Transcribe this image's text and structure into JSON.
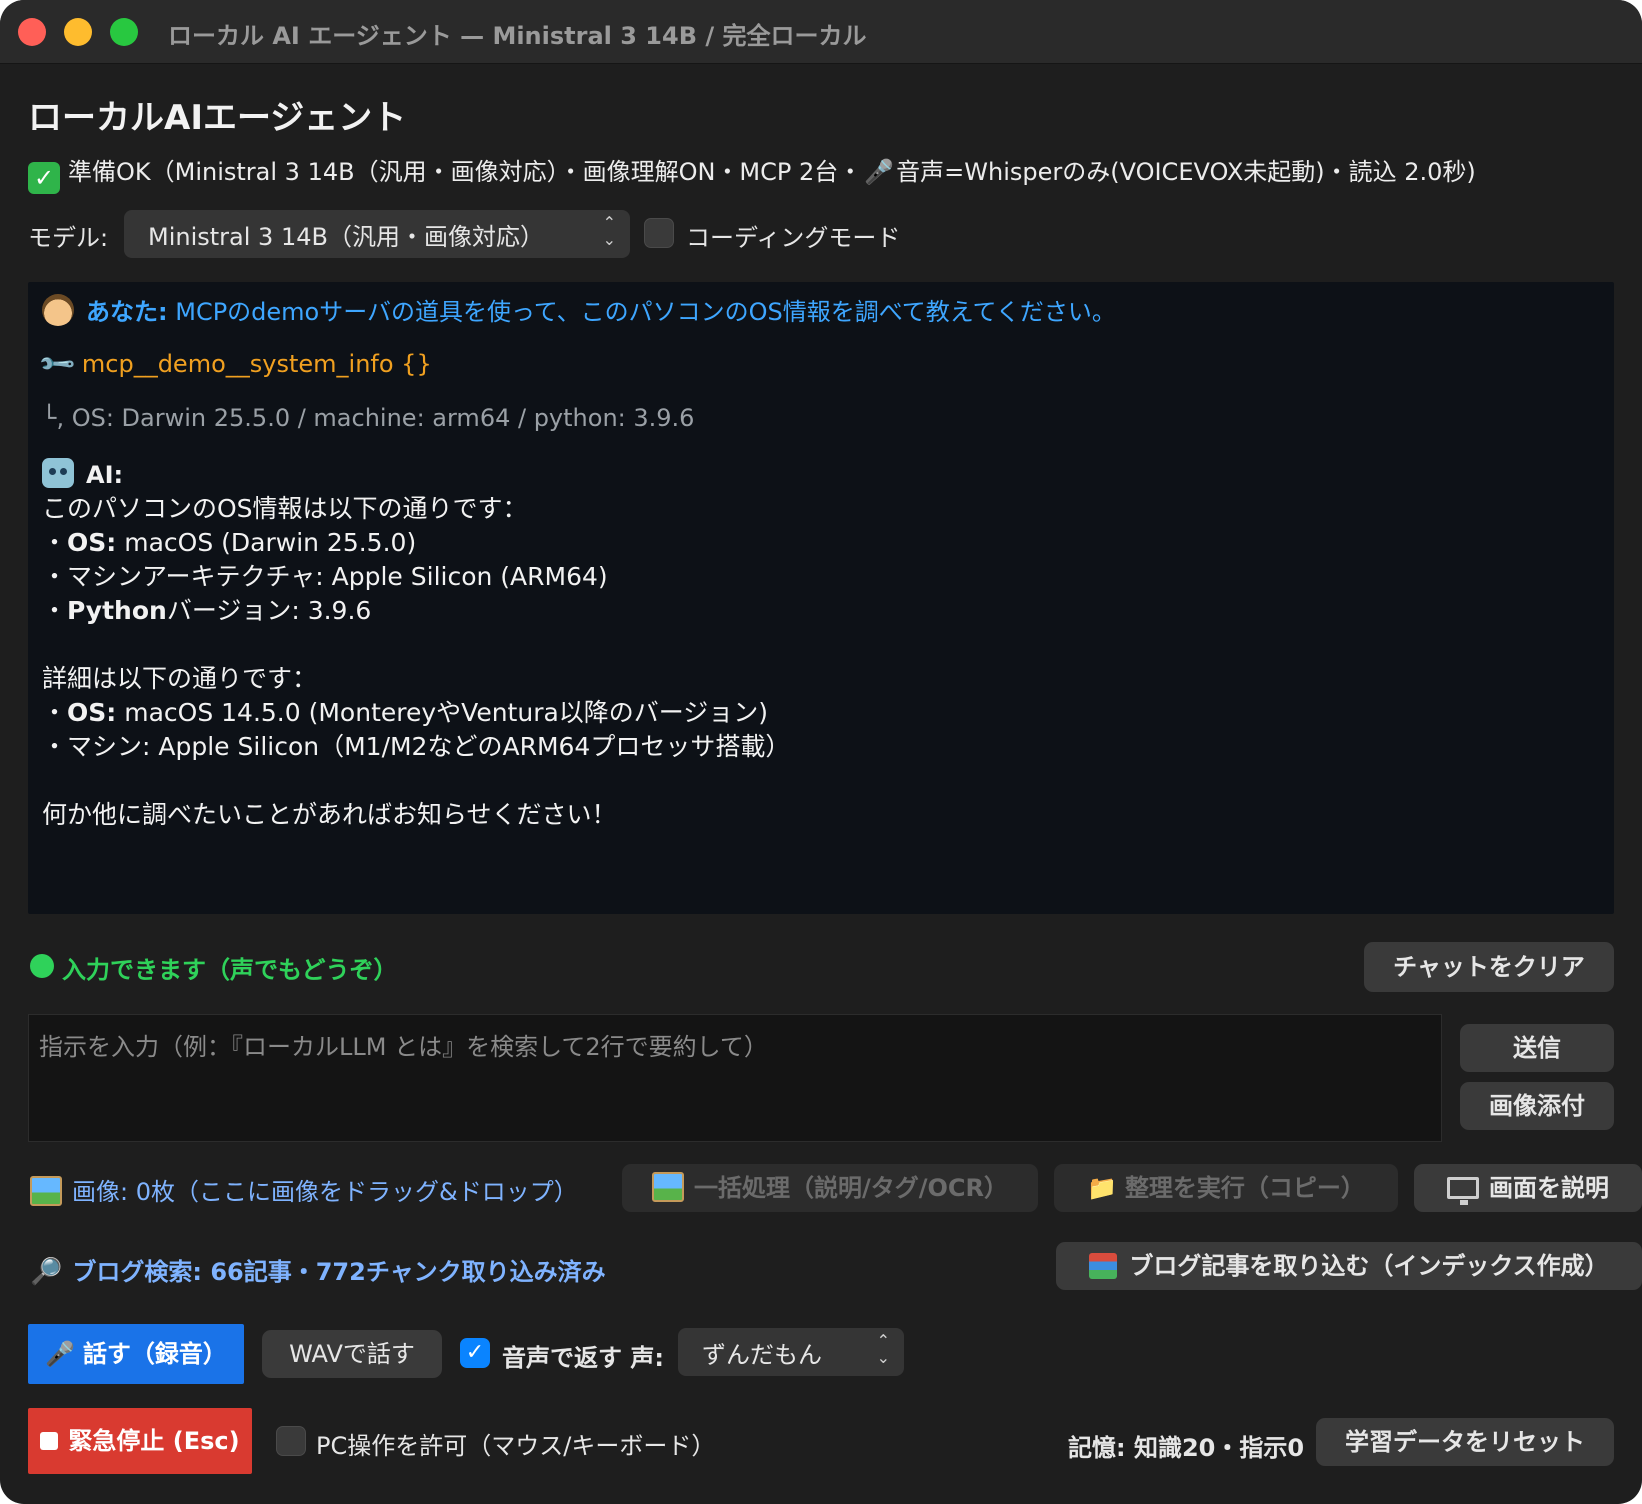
{
  "window": {
    "title": "ローカル AI エージェント — Ministral 3 14B / 完全ローカル"
  },
  "header": {
    "app_title": "ローカルAIエージェント",
    "status_check": "✓",
    "status_text_before_mic": "準備OK（Ministral 3 14B（汎用・画像対応）・画像理解ON・MCP 2台・",
    "status_text_after_mic": "音声=Whisperのみ(VOICEVOX未起動)・読込 2.0秒)"
  },
  "model": {
    "label": "モデル:",
    "selected": "Ministral 3 14B（汎用・画像対応）",
    "coding_mode_label": "コーディングモード",
    "coding_mode_checked": false
  },
  "chat": {
    "user_prefix": "あなた:",
    "user_message": " MCPのdemoサーバの道具を使って、このパソコンのOS情報を調べて教えてください。",
    "tool_call": "mcp__demo__system_info {}",
    "tool_result_arrow": "└,",
    "tool_result": "OS: Darwin 25.5.0 / machine: arm64 / python: 3.9.6",
    "ai_prefix": "AI:",
    "ai_lines": [
      {
        "bold": "",
        "text": "このパソコンのOS情報は以下の通りです："
      },
      {
        "bullet": "・",
        "bold": "OS:",
        "text": " macOS (Darwin 25.5.0)"
      },
      {
        "bullet": "・",
        "bold": "",
        "text": "マシンアーキテクチャ: Apple Silicon (ARM64)"
      },
      {
        "bullet": "・",
        "bold": "Python",
        "text": "バージョン: 3.9.6"
      },
      {
        "bold": "",
        "text": ""
      },
      {
        "bold": "",
        "text": "詳細は以下の通りです："
      },
      {
        "bullet": "・",
        "bold": "OS:",
        "text": " macOS 14.5.0 (MontereyやVentura以降のバージョン)"
      },
      {
        "bullet": "・",
        "bold": "",
        "text": "マシン: Apple Silicon（M1/M2などのARM64プロセッサ搭載）"
      },
      {
        "bold": "",
        "text": ""
      },
      {
        "bold": "",
        "text": "何か他に調べたいことがあればお知らせください！"
      }
    ]
  },
  "status": {
    "ready_text": "入力できます（声でもどうぞ）",
    "clear_chat": "チャットをクリア"
  },
  "input": {
    "placeholder": "指示を入力（例：『ローカルLLM とは』を検索して2行で要約して）",
    "value": "",
    "send": "送信",
    "attach_image": "画像添付"
  },
  "images": {
    "label": "画像: 0枚（ここに画像をドラッグ&ドロップ）",
    "batch": "一括処理（説明/タグ/OCR）",
    "organize": "整理を実行（コピー）",
    "describe_screen": "画面を説明"
  },
  "blog": {
    "label": "ブログ検索: 66記事・772チャンク取り込み済み",
    "ingest": "ブログ記事を取り込む（インデックス作成）"
  },
  "voice": {
    "talk": "話す（録音）",
    "wav": "WAVで話す",
    "reply_with_voice_label": "音声で返す 声:",
    "reply_with_voice_checked": true,
    "voice_selected": "ずんだもん"
  },
  "bottom": {
    "emergency_stop": "緊急停止 (Esc)",
    "pc_control_label": "PC操作を許可（マウス/キーボード）",
    "pc_control_checked": false,
    "memory": "記憶: 知識20・指示0",
    "reset_learning": "学習データをリセット"
  },
  "colors": {
    "window_bg": "#1e1e1e",
    "chat_bg": "#0d1117",
    "user_text": "#3ea6ff",
    "tool_text": "#f0a020",
    "ready_green": "#2fd25a",
    "talk_blue": "#1a73e8",
    "stop_red": "#d93a30"
  }
}
